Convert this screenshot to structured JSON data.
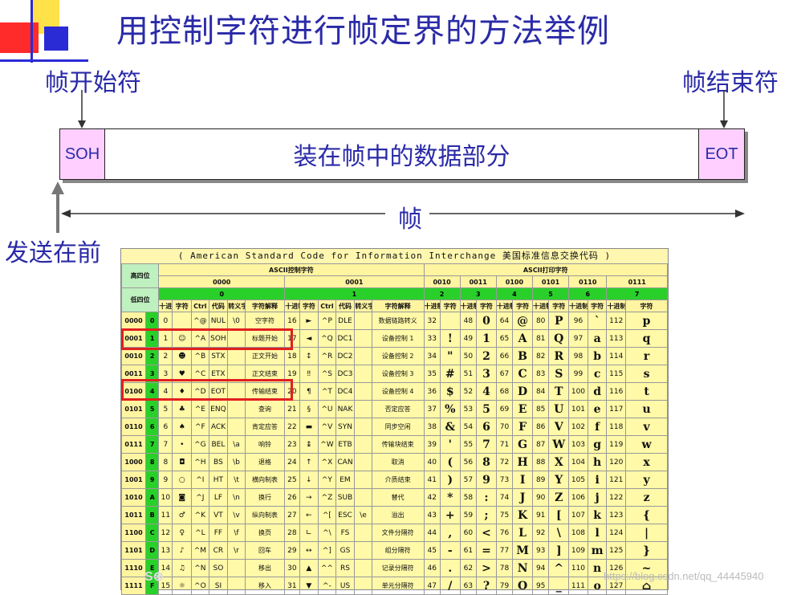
{
  "title": "用控制字符进行帧定界的方法举例",
  "labels": {
    "frame_start": "帧开始符",
    "frame_end": "帧结束符",
    "send_first": "发送在前",
    "frame": "帧"
  },
  "frame": {
    "soh": "SOH",
    "data": "装在帧中的数据部分",
    "eot": "EOT"
  },
  "ascii_table": {
    "header": "( American Standard Code for Information Interchange  美国标准信息交换代码 )",
    "high_label": "高四位",
    "low_label": "低四位",
    "control_title": "ASCII控制字符",
    "print_title": "ASCII打印字符",
    "groups": [
      "0000",
      "0001",
      "0010",
      "0011",
      "0100",
      "0101",
      "0110",
      "0111"
    ],
    "group_nums": [
      "0",
      "1",
      "2",
      "3",
      "4",
      "5",
      "6",
      "7"
    ],
    "subheads": {
      "dec": "十进制",
      "char": "字符",
      "ctrl": "Ctrl",
      "code": "代码",
      "esc": "转义字符",
      "meaning": "字符解释"
    },
    "rows": [
      [
        "0000",
        "0",
        "0",
        "",
        "^@",
        "NUL",
        "\\0",
        "空字符",
        "16",
        "►",
        "^P",
        "DLE",
        "",
        "数据链路转义",
        "32",
        "",
        "48",
        "0",
        "64",
        "@",
        "80",
        "P",
        "96",
        "`",
        "112",
        "p"
      ],
      [
        "0001",
        "1",
        "1",
        "☺",
        "^A",
        "SOH",
        "",
        "标题开始",
        "17",
        "◄",
        "^Q",
        "DC1",
        "",
        "设备控制 1",
        "33",
        "!",
        "49",
        "1",
        "65",
        "A",
        "81",
        "Q",
        "97",
        "a",
        "113",
        "q"
      ],
      [
        "0010",
        "2",
        "2",
        "☻",
        "^B",
        "STX",
        "",
        "正文开始",
        "18",
        "↕",
        "^R",
        "DC2",
        "",
        "设备控制 2",
        "34",
        "\"",
        "50",
        "2",
        "66",
        "B",
        "82",
        "R",
        "98",
        "b",
        "114",
        "r"
      ],
      [
        "0011",
        "3",
        "3",
        "♥",
        "^C",
        "ETX",
        "",
        "正文结束",
        "19",
        "‼",
        "^S",
        "DC3",
        "",
        "设备控制 3",
        "35",
        "#",
        "51",
        "3",
        "67",
        "C",
        "83",
        "S",
        "99",
        "c",
        "115",
        "s"
      ],
      [
        "0100",
        "4",
        "4",
        "♦",
        "^D",
        "EOT",
        "",
        "传输结束",
        "20",
        "¶",
        "^T",
        "DC4",
        "",
        "设备控制 4",
        "36",
        "$",
        "52",
        "4",
        "68",
        "D",
        "84",
        "T",
        "100",
        "d",
        "116",
        "t"
      ],
      [
        "0101",
        "5",
        "5",
        "♣",
        "^E",
        "ENQ",
        "",
        "查询",
        "21",
        "§",
        "^U",
        "NAK",
        "",
        "否定应答",
        "37",
        "%",
        "53",
        "5",
        "69",
        "E",
        "85",
        "U",
        "101",
        "e",
        "117",
        "u"
      ],
      [
        "0110",
        "6",
        "6",
        "♠",
        "^F",
        "ACK",
        "",
        "肯定应答",
        "22",
        "▬",
        "^V",
        "SYN",
        "",
        "同步空闲",
        "38",
        "&",
        "54",
        "6",
        "70",
        "F",
        "86",
        "V",
        "102",
        "f",
        "118",
        "v"
      ],
      [
        "0111",
        "7",
        "7",
        "•",
        "^G",
        "BEL",
        "\\a",
        "响铃",
        "23",
        "↨",
        "^W",
        "ETB",
        "",
        "传输块结束",
        "39",
        "'",
        "55",
        "7",
        "71",
        "G",
        "87",
        "W",
        "103",
        "g",
        "119",
        "w"
      ],
      [
        "1000",
        "8",
        "8",
        "◘",
        "^H",
        "BS",
        "\\b",
        "退格",
        "24",
        "↑",
        "^X",
        "CAN",
        "",
        "取消",
        "40",
        "(",
        "56",
        "8",
        "72",
        "H",
        "88",
        "X",
        "104",
        "h",
        "120",
        "x"
      ],
      [
        "1001",
        "9",
        "9",
        "○",
        "^I",
        "HT",
        "\\t",
        "横向制表",
        "25",
        "↓",
        "^Y",
        "EM",
        "",
        "介质结束",
        "41",
        ")",
        "57",
        "9",
        "73",
        "I",
        "89",
        "Y",
        "105",
        "i",
        "121",
        "y"
      ],
      [
        "1010",
        "A",
        "10",
        "◙",
        "^J",
        "LF",
        "\\n",
        "换行",
        "26",
        "→",
        "^Z",
        "SUB",
        "",
        "替代",
        "42",
        "*",
        "58",
        ":",
        "74",
        "J",
        "90",
        "Z",
        "106",
        "j",
        "122",
        "z"
      ],
      [
        "1011",
        "B",
        "11",
        "♂",
        "^K",
        "VT",
        "\\v",
        "纵向制表",
        "27",
        "←",
        "^[",
        "ESC",
        "\\e",
        "溢出",
        "43",
        "+",
        "59",
        ";",
        "75",
        "K",
        "91",
        "[",
        "107",
        "k",
        "123",
        "{"
      ],
      [
        "1100",
        "C",
        "12",
        "♀",
        "^L",
        "FF",
        "\\f",
        "换页",
        "28",
        "∟",
        "^\\",
        "FS",
        "",
        "文件分隔符",
        "44",
        ",",
        "60",
        "<",
        "76",
        "L",
        "92",
        "\\",
        "108",
        "l",
        "124",
        "|"
      ],
      [
        "1101",
        "D",
        "13",
        "♪",
        "^M",
        "CR",
        "\\r",
        "回车",
        "29",
        "↔",
        "^]",
        "GS",
        "",
        "组分隔符",
        "45",
        "-",
        "61",
        "=",
        "77",
        "M",
        "93",
        "]",
        "109",
        "m",
        "125",
        "}"
      ],
      [
        "1110",
        "E",
        "14",
        "♫",
        "^N",
        "SO",
        "",
        "移出",
        "30",
        "▲",
        "^^",
        "RS",
        "",
        "记录分隔符",
        "46",
        ".",
        "62",
        ">",
        "78",
        "N",
        "94",
        "^",
        "110",
        "n",
        "126",
        "~"
      ],
      [
        "1111",
        "F",
        "15",
        "☼",
        "^O",
        "SI",
        "",
        "移入",
        "31",
        "▼",
        "^-",
        "US",
        "",
        "单元分隔符",
        "47",
        "/",
        "63",
        "?",
        "79",
        "O",
        "95",
        "_",
        "111",
        "o",
        "127",
        "⌂"
      ]
    ]
  },
  "watermark": "https://blog.csdn.net/qq_44445940",
  "colors": {
    "title_blue": "#2a2aa8",
    "frame_pink": "#ffd0ff",
    "highlight_red": "#e02020",
    "table_yellow": "#fff9a8",
    "table_green": "#2ad02a"
  }
}
